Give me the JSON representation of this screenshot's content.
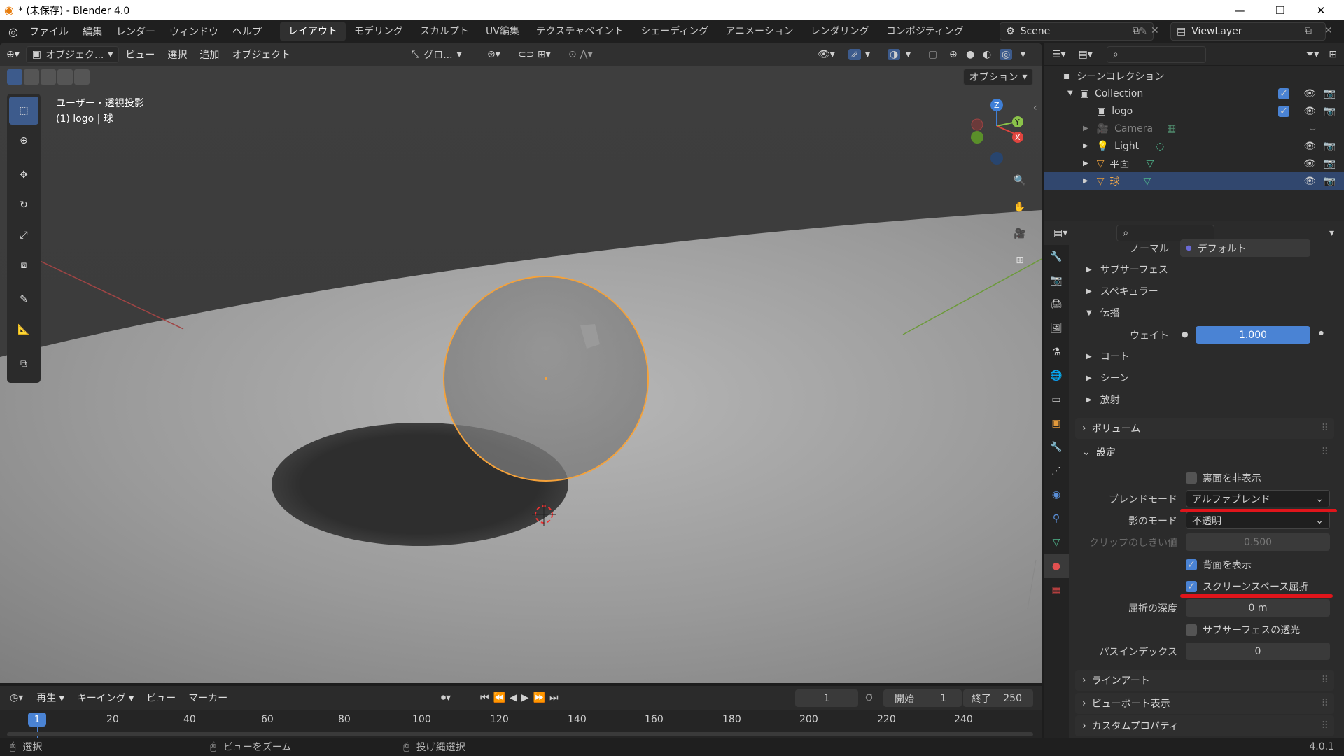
{
  "window": {
    "title": "* (未保存) - Blender 4.0",
    "minimize": "—",
    "maximize": "❐",
    "close": "✕"
  },
  "menubar": {
    "menus": [
      "ファイル",
      "編集",
      "レンダー",
      "ウィンドウ",
      "ヘルプ"
    ],
    "workspaces": [
      "レイアウト",
      "モデリング",
      "スカルプト",
      "UV編集",
      "テクスチャペイント",
      "シェーディング",
      "アニメーション",
      "レンダリング",
      "コンポジティング"
    ],
    "active_workspace": 0,
    "scene": "Scene",
    "view_layer": "ViewLayer"
  },
  "viewport": {
    "mode": "オブジェク...",
    "menus": [
      "ビュー",
      "選択",
      "追加",
      "オブジェクト"
    ],
    "transform_orientation": "グロ...",
    "options_label": "オプション",
    "overlay_title": "ユーザー・透視投影",
    "overlay_sub": "(1) logo | 球",
    "gizmo": {
      "z": "Z",
      "y": "Y",
      "x": "X"
    }
  },
  "outliner": {
    "scene_collection": "シーンコレクション",
    "items": [
      {
        "name": "Collection",
        "type": "collection",
        "indent": 1
      },
      {
        "name": "logo",
        "type": "collection",
        "indent": 2
      },
      {
        "name": "Camera",
        "type": "camera",
        "indent": 2
      },
      {
        "name": "Light",
        "type": "light",
        "indent": 2
      },
      {
        "name": "平面",
        "type": "mesh",
        "indent": 2
      },
      {
        "name": "球",
        "type": "mesh",
        "indent": 2,
        "selected": true
      }
    ]
  },
  "properties": {
    "normal_label": "ノーマル",
    "normal_value": "デフォルト",
    "sections": [
      "サブサーフェス",
      "スペキュラー",
      "伝播"
    ],
    "weight_label": "ウェイト",
    "weight_value": "1.000",
    "sections2": [
      "コート",
      "シーン",
      "放射"
    ],
    "volume": "ボリューム",
    "settings": "設定",
    "backface_hide": "裏面を非表示",
    "blend_mode_label": "ブレンドモード",
    "blend_mode_value": "アルファブレンド",
    "shadow_mode_label": "影のモード",
    "shadow_mode_value": "不透明",
    "clip_label": "クリップのしきい値",
    "clip_value": "0.500",
    "show_backface": "背面を表示",
    "ssr": "スクリーンスペース屈折",
    "refraction_depth_label": "屈折の深度",
    "refraction_depth_value": "0 m",
    "subsurface_translucency": "サブサーフェスの透光",
    "pass_index_label": "パスインデックス",
    "pass_index_value": "0",
    "lineart": "ラインアート",
    "viewport_display": "ビューポート表示",
    "custom_props": "カスタムプロパティ"
  },
  "timeline": {
    "menus": [
      "再生",
      "キーイング",
      "ビュー",
      "マーカー"
    ],
    "current_frame": "1",
    "start_label": "開始",
    "start_value": "1",
    "end_label": "終了",
    "end_value": "250",
    "ticks": [
      "1",
      "20",
      "40",
      "60",
      "80",
      "100",
      "120",
      "140",
      "160",
      "180",
      "200",
      "220",
      "240"
    ]
  },
  "status": {
    "select": "選択",
    "zoom": "ビューをズーム",
    "lasso": "投げ縄選択",
    "version": "4.0.1"
  },
  "colors": {
    "accent": "#4a83d4",
    "selection_outline": "#f5a23a",
    "annotation": "#e0151b"
  }
}
